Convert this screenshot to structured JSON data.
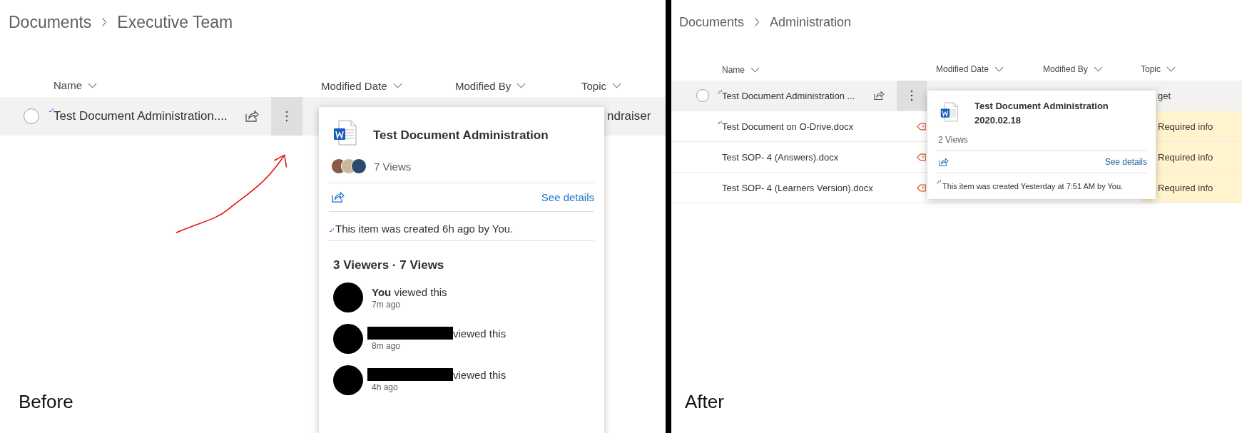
{
  "panels": [
    {
      "label": "Before",
      "breadcrumb": [
        "Documents",
        "Executive Team"
      ],
      "columns": [
        "Name",
        "Modified Date",
        "Modified By",
        "Topic"
      ],
      "arrow": true,
      "rows": [
        {
          "name": "Test Document Administration....",
          "hovered": true,
          "new": true,
          "topic": "ndraiser",
          "topic_missing": false
        }
      ],
      "popup": {
        "title": "Test Document Administration",
        "facepile": true,
        "views": "7 Views",
        "see_details": "See details",
        "created": "This item was created 6h ago by You.",
        "viewers_heading": "3 Viewers · 7 Views",
        "viewers": [
          {
            "redacted": false,
            "text": "**You** viewed this",
            "time": "7m ago"
          },
          {
            "redacted": true,
            "text": "viewed this",
            "time": "8m ago"
          },
          {
            "redacted": true,
            "text": "viewed this",
            "time": "4h ago"
          }
        ]
      }
    },
    {
      "label": "After",
      "breadcrumb": [
        "Documents",
        "Administration"
      ],
      "columns": [
        "Name",
        "Modified Date",
        "Modified By",
        "Topic"
      ],
      "rows": [
        {
          "name": "Test Document Administration ...",
          "hovered": true,
          "new": true,
          "topic": "get",
          "topic_missing": false
        },
        {
          "name": "Test Document on O-Drive.docx",
          "hovered": false,
          "new": true,
          "flagged": true,
          "topic": "Required info",
          "topic_missing": true
        },
        {
          "name": "Test SOP- 4 (Answers).docx",
          "hovered": false,
          "new": false,
          "flagged": true,
          "topic": "Required info",
          "topic_missing": true
        },
        {
          "name": "Test SOP- 4 (Learners Version).docx",
          "hovered": false,
          "new": false,
          "flagged": true,
          "topic": "Required info",
          "topic_missing": true
        }
      ],
      "popup": {
        "title": "Test Document Administration 2020.02.18",
        "views": "2 Views",
        "see_details": "See details",
        "created": "This item was created Yesterday at 7:51 AM by You."
      }
    }
  ]
}
